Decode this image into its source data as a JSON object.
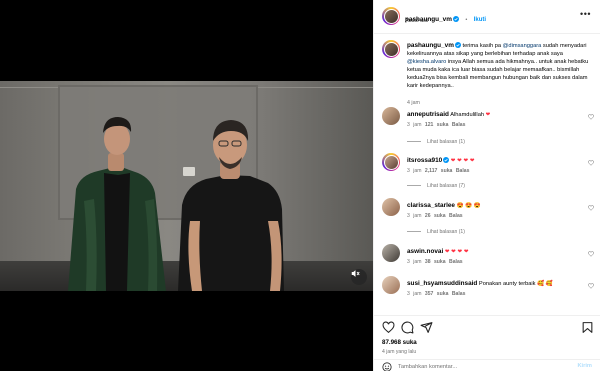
{
  "header": {
    "username": "pashaungu_vm",
    "separator": "•",
    "follow_label": "Ikuti",
    "audio_label": "Audio asli"
  },
  "caption": {
    "username": "pashaungu_vm",
    "text_1": "terima kasih pa ",
    "mention_1": "@dimsanggara",
    "text_2": " sudah menyadari kekeliruannya atas sikap yang berlebihan terhadap anak saya ",
    "mention_2": "@kiesha.alvaro",
    "text_3": " insya Allah semua ada hikmahnya.. untuk anak hebatku ketua muda kaka ica luar biasa sudah belajar memaafkan.. bismillah kedua2nya bisa kembali membangun hubungan baik dan sukses dalam karir kedepannya..",
    "time": "4 jam"
  },
  "comments": [
    {
      "username": "anneputrisaid",
      "text": "Alhamdulillah",
      "emoji": "❤",
      "time": "3 jam",
      "likes": "121 suka",
      "reply_label": "Balas",
      "replies": "Lihat balasan (1)"
    },
    {
      "username": "itsrossa910",
      "text": "",
      "emoji": "❤ ❤ ❤ ❤",
      "time": "3 jam",
      "likes": "2,117 suka",
      "reply_label": "Balas",
      "replies": "Lihat balasan (7)"
    },
    {
      "username": "clarissa_starlee",
      "text": "",
      "emoji": "😍 😍 😍",
      "time": "3 jam",
      "likes": "26 suka",
      "reply_label": "Balas",
      "replies": "Lihat balasan (1)"
    },
    {
      "username": "aswin.novai",
      "text": "",
      "emoji": "❤ ❤ ❤ ❤",
      "time": "3 jam",
      "likes": "38 suka",
      "reply_label": "Balas",
      "replies": ""
    },
    {
      "username": "susi_hsyamsuddinsaid",
      "text": "Ponakan aunty terbaik",
      "emoji": "🥰 🥰",
      "time": "3 jam",
      "likes": "357 suka",
      "reply_label": "Balas",
      "replies": ""
    }
  ],
  "footer": {
    "likes": "87.968 suka",
    "time_ago": "4 jam yang lalu",
    "comment_placeholder": "Tambahkan komentar...",
    "post_label": "Kirim"
  },
  "colors": {
    "link_blue": "#0095f6",
    "mention_blue": "#00376b",
    "heart_red": "#ff3040",
    "verified_blue": "#0095f6"
  },
  "icons": {
    "video_controls": "volume-muted-icon",
    "actions": [
      "heart-icon",
      "comment-icon",
      "share-icon",
      "bookmark-icon"
    ]
  }
}
